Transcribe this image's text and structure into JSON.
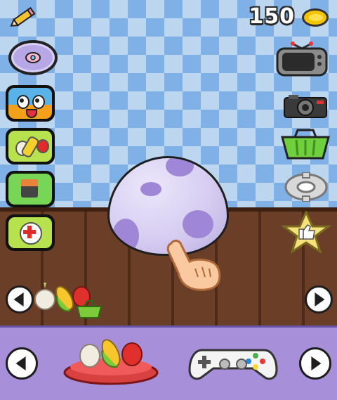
{
  "hud": {
    "coin_count": "150"
  },
  "icons": {
    "edit": "pencil-icon",
    "coin": "coin-icon",
    "pacifier": "pacifier-icon",
    "face": "character-face-icon",
    "food": "food-icon",
    "bath": "bathtub-icon",
    "health": "first-aid-icon",
    "tv": "tv-icon",
    "camera": "camera-icon",
    "shop": "shopping-basket-icon",
    "settings": "gear-icon",
    "rate": "thumbs-up-star-icon",
    "play": "gamepad-icon",
    "food_bowl": "food-bowl-icon"
  },
  "colors": {
    "wallpaper_light": "#bdd6ef",
    "wallpaper_dark": "#7fb0e6",
    "floor": "#6b3e27",
    "bottom_bar": "#a88fd9",
    "egg": "#d6cdf1",
    "egg_spots": "#9f86d6",
    "coin": "#f5c400"
  }
}
